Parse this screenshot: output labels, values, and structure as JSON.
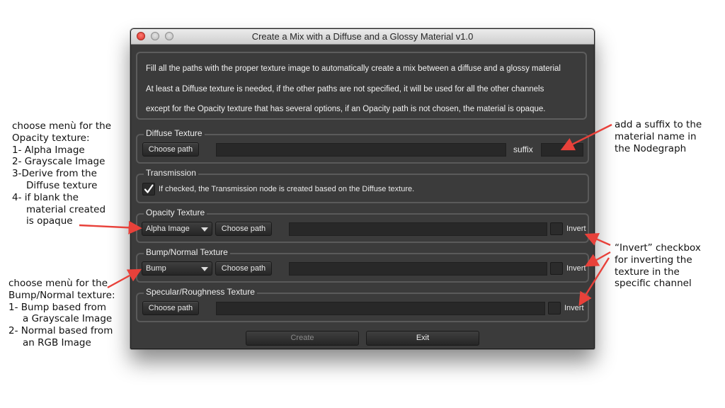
{
  "window": {
    "title": "Create a Mix with a Diffuse and a Glossy Material v1.0"
  },
  "info": {
    "lines": [
      "Fill all the paths with the proper texture image to automatically create a mix between a diffuse and a glossy material",
      "At least a Diffuse texture is needed, if the other paths are not specified, it will be used for all the other channels",
      "except for the Opacity texture that has several options, if an Opacity path is not chosen, the material is opaque."
    ]
  },
  "diffuse": {
    "title": "Diffuse Texture",
    "choose_label": "Choose path",
    "path_value": "",
    "suffix_label": "suffix",
    "suffix_value": ""
  },
  "transmission": {
    "title": "Transmission",
    "checkbox_label": "If checked, the Transmission node is created based on the Diffuse texture.",
    "checked": true
  },
  "opacity": {
    "title": "Opacity Texture",
    "mode_selected": "Alpha Image",
    "choose_label": "Choose path",
    "path_value": "",
    "invert_label": "Invert"
  },
  "bump": {
    "title": "Bump/Normal Texture",
    "mode_selected": "Bump",
    "choose_label": "Choose path",
    "path_value": "",
    "invert_label": "Invert"
  },
  "specular": {
    "title": "Specular/Roughness Texture",
    "choose_label": "Choose path",
    "path_value": "",
    "invert_label": "Invert"
  },
  "actions": {
    "create_label": "Create",
    "exit_label": "Exit"
  },
  "annotations": {
    "opacity_menu": [
      "choose menù for the",
      "Opacity texture:",
      "1- Alpha Image",
      "2- Grayscale Image",
      "3-Derive from the",
      "Diffuse texture",
      "4- if blank the",
      "material created",
      "is opaque"
    ],
    "bump_menu": [
      "choose menù for the",
      "Bump/Normal texture:",
      "1- Bump based from",
      "a Grayscale Image",
      "2- Normal based from",
      "an RGB Image"
    ],
    "suffix_note": [
      "add a suffix to the",
      "material name in",
      "the Nodegraph"
    ],
    "invert_note": [
      "“Invert” checkbox",
      "for inverting the",
      "texture in the",
      "specific channel"
    ]
  },
  "colors": {
    "arrow": "#e8413a",
    "panel": "#3b3b3b",
    "disabled_text": "#8a8a8a"
  }
}
